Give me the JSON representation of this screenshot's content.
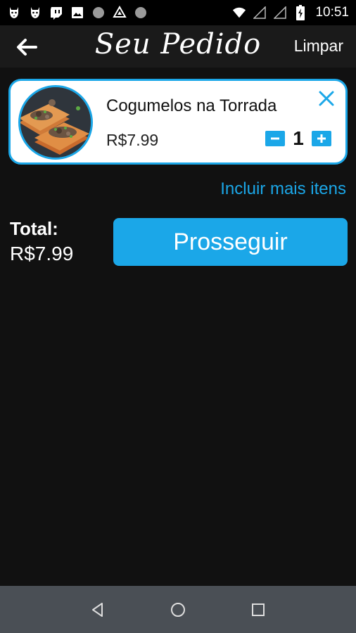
{
  "status_bar": {
    "time": "10:51",
    "icons": [
      "dog-icon",
      "dog-icon",
      "twitch-icon",
      "image-icon",
      "circle-icon",
      "drive-icon",
      "circle-icon",
      "wifi-icon",
      "signal-icon",
      "signal-icon",
      "battery-icon"
    ]
  },
  "app_bar": {
    "title": "Seu Pedido",
    "clear_label": "Limpar"
  },
  "item": {
    "name": "Cogumelos na Torrada",
    "price": "R$7.99",
    "quantity": "1"
  },
  "more_link": "Incluir mais itens",
  "total": {
    "label": "Total:",
    "value": "R$7.99"
  },
  "proceed_label": "Prosseguir",
  "colors": {
    "accent": "#1ba7e8",
    "background": "#111111",
    "app_bar": "#1a1a1a",
    "nav_bar": "#4a4f55"
  }
}
